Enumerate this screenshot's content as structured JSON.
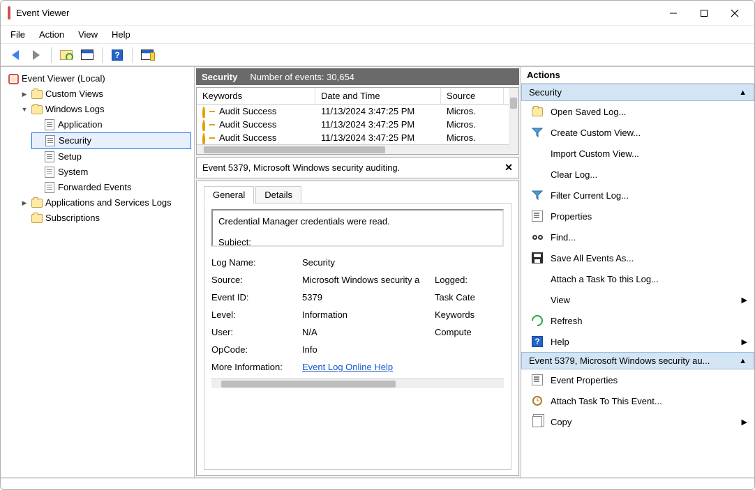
{
  "window": {
    "title": "Event Viewer"
  },
  "menu": [
    "File",
    "Action",
    "View",
    "Help"
  ],
  "tree": {
    "root": "Event Viewer (Local)",
    "custom": "Custom Views",
    "winlogs": "Windows Logs",
    "winlogs_children": [
      "Application",
      "Security",
      "Setup",
      "System",
      "Forwarded Events"
    ],
    "apps": "Applications and Services Logs",
    "subs": "Subscriptions"
  },
  "events": {
    "title": "Security",
    "count": "Number of events: 30,654",
    "cols": [
      "Keywords",
      "Date and Time",
      "Source"
    ],
    "rows": [
      {
        "kw": "Audit Success",
        "dt": "11/13/2024 3:47:25 PM",
        "src": "Micros."
      },
      {
        "kw": "Audit Success",
        "dt": "11/13/2024 3:47:25 PM",
        "src": "Micros."
      },
      {
        "kw": "Audit Success",
        "dt": "11/13/2024 3:47:25 PM",
        "src": "Micros."
      }
    ]
  },
  "detail": {
    "header": "Event 5379, Microsoft Windows security auditing.",
    "tabs": [
      "General",
      "Details"
    ],
    "message1": "Credential Manager credentials were read.",
    "message2": "Subject:",
    "props": {
      "log_name_l": "Log Name:",
      "log_name_v": "Security",
      "source_l": "Source:",
      "source_v": "Microsoft Windows security a",
      "logged_l": "Logged:",
      "eid_l": "Event ID:",
      "eid_v": "5379",
      "task_l": "Task Cate",
      "level_l": "Level:",
      "level_v": "Information",
      "kw_l": "Keywords",
      "user_l": "User:",
      "user_v": "N/A",
      "comp_l": "Compute",
      "op_l": "OpCode:",
      "op_v": "Info",
      "more_l": "More Information:",
      "more_v": "Event Log Online Help"
    }
  },
  "actions": {
    "title": "Actions",
    "sec_header": "Security",
    "items1": [
      {
        "icon": "folder",
        "label": "Open Saved Log..."
      },
      {
        "icon": "filter",
        "label": "Create Custom View..."
      },
      {
        "icon": "none",
        "label": "Import Custom View..."
      },
      {
        "icon": "none",
        "label": "Clear Log..."
      },
      {
        "icon": "filter",
        "label": "Filter Current Log..."
      },
      {
        "icon": "prop",
        "label": "Properties"
      },
      {
        "icon": "binoc",
        "label": "Find..."
      },
      {
        "icon": "save",
        "label": "Save All Events As..."
      },
      {
        "icon": "none",
        "label": "Attach a Task To this Log..."
      },
      {
        "icon": "none",
        "label": "View",
        "submenu": true
      },
      {
        "icon": "refresh",
        "label": "Refresh"
      },
      {
        "icon": "help",
        "label": "Help",
        "submenu": true
      }
    ],
    "ev_header": "Event 5379, Microsoft Windows security au...",
    "items2": [
      {
        "icon": "prop",
        "label": "Event Properties"
      },
      {
        "icon": "task",
        "label": "Attach Task To This Event..."
      },
      {
        "icon": "copy",
        "label": "Copy",
        "submenu": true
      }
    ]
  }
}
